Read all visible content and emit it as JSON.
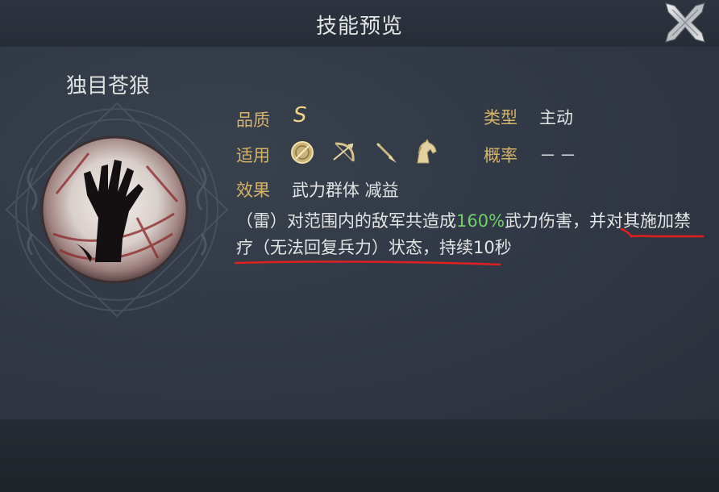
{
  "header": {
    "title": "技能预览"
  },
  "skill": {
    "name": "独目苍狼",
    "quality_label": "品质",
    "quality_value": "S",
    "type_label": "类型",
    "type_value": "主动",
    "applies_label": "适用",
    "applies_icons": [
      "shield-icon",
      "bow-icon",
      "spear-icon",
      "horse-icon"
    ],
    "chance_label": "概率",
    "chance_value": "－－",
    "effect_label": "效果",
    "effect_value": "武力群体 减益",
    "description": {
      "part1": "（雷）对范围内的敌军共造成",
      "highlight": "160%",
      "part2": "武力伤害，并对其施加禁疗（无法回复兵力）状态，持续10秒"
    }
  },
  "colors": {
    "label_gold": "#d6b36a",
    "highlight_green": "#6fcf6a",
    "annotation_red": "#e02020"
  }
}
